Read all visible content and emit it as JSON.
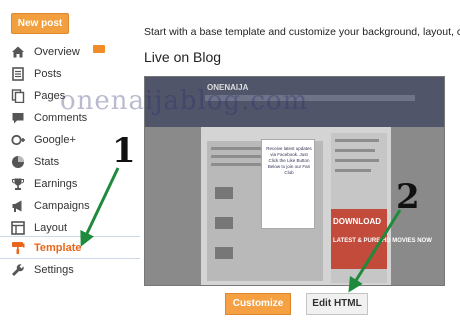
{
  "new_post_label": "New post",
  "sidebar": {
    "items": [
      {
        "label": "Overview",
        "icon": "home-icon"
      },
      {
        "label": "Posts",
        "icon": "posts-icon"
      },
      {
        "label": "Pages",
        "icon": "pages-icon"
      },
      {
        "label": "Comments",
        "icon": "comment-icon"
      },
      {
        "label": "Google+",
        "icon": "google-plus-icon"
      },
      {
        "label": "Stats",
        "icon": "stats-icon"
      },
      {
        "label": "Earnings",
        "icon": "trophy-icon"
      },
      {
        "label": "Campaigns",
        "icon": "campaign-icon"
      },
      {
        "label": "Layout",
        "icon": "layout-icon"
      },
      {
        "label": "Template",
        "icon": "template-icon"
      },
      {
        "label": "Settings",
        "icon": "wrench-icon"
      }
    ],
    "active": "Template"
  },
  "main": {
    "intro": "Start with a base template and customize your background, layout, colo",
    "live_title": "Live on Blog",
    "preview": {
      "brand": "ONENAIJA",
      "dialog_text": "Receive latest updates via Facebook. Just Click the Like Button Below to join our Fan Club",
      "ad_line1": "DOWNLOAD",
      "ad_line2": "LATEST & PURE HD MOVIES NOW"
    },
    "customize_label": "Customize",
    "edit_html_label": "Edit HTML"
  },
  "watermark": "onenaijablog.com",
  "annotations": {
    "step1": "1",
    "step2": "2"
  },
  "colors": {
    "accent": "#f2a03f",
    "active_text": "#e8651a",
    "arrow": "#1f8a3c"
  }
}
